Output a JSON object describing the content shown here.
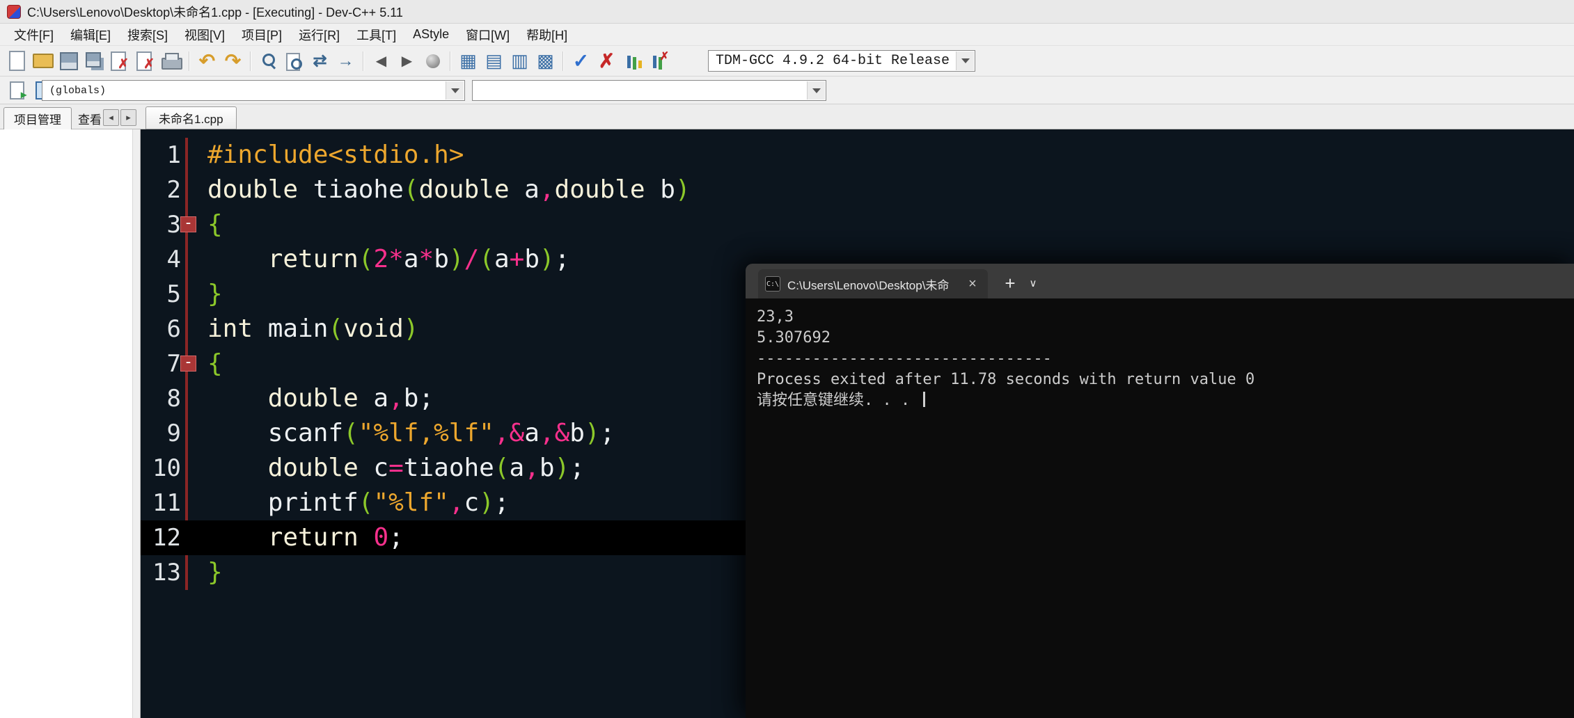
{
  "window": {
    "title": "C:\\Users\\Lenovo\\Desktop\\未命名1.cpp - [Executing] - Dev-C++ 5.11"
  },
  "menu": {
    "items": [
      "文件[F]",
      "编辑[E]",
      "搜索[S]",
      "视图[V]",
      "项目[P]",
      "运行[R]",
      "工具[T]",
      "AStyle",
      "窗口[W]",
      "帮助[H]"
    ]
  },
  "toolbar": {
    "compiler": "TDM-GCC 4.9.2 64-bit Release",
    "groups": [
      [
        "new-file",
        "open",
        "save",
        "save-all",
        "close",
        "close-all",
        "print"
      ],
      [
        "undo",
        "redo"
      ],
      [
        "find",
        "find-in-files",
        "replace",
        "goto-line"
      ],
      [
        "back",
        "forward",
        "run-to-cursor"
      ],
      [
        "compile",
        "run",
        "compile-run",
        "rebuild-all"
      ],
      [
        "syntax-check",
        "abort",
        "profile",
        "profile-delete"
      ]
    ]
  },
  "toolbar2": {
    "buttons": [
      "insert",
      "class-browser"
    ],
    "globals": "(globals)",
    "members": ""
  },
  "panel": {
    "project_label": "项目管理",
    "view_label": "查看"
  },
  "editor_tab": {
    "label": "未命名1.cpp"
  },
  "editor": {
    "lines": [
      {
        "num": 1,
        "tokens": [
          [
            "pre",
            "#include<stdio.h>"
          ]
        ]
      },
      {
        "num": 2,
        "tokens": [
          [
            "kw",
            "double"
          ],
          [
            "pl",
            " tiaohe"
          ],
          [
            "br",
            "("
          ],
          [
            "kw",
            "double"
          ],
          [
            "pl",
            " a"
          ],
          [
            "op",
            ","
          ],
          [
            "kw",
            "double"
          ],
          [
            "pl",
            " b"
          ],
          [
            "br",
            ")"
          ]
        ]
      },
      {
        "num": 3,
        "fold": true,
        "tokens": [
          [
            "br",
            "{"
          ]
        ]
      },
      {
        "num": 4,
        "tokens": [
          [
            "pl",
            "    "
          ],
          [
            "kw",
            "return"
          ],
          [
            "br",
            "("
          ],
          [
            "num",
            "2"
          ],
          [
            "op",
            "*"
          ],
          [
            "pl",
            "a"
          ],
          [
            "op",
            "*"
          ],
          [
            "pl",
            "b"
          ],
          [
            "br",
            ")"
          ],
          [
            "op",
            "/"
          ],
          [
            "br",
            "("
          ],
          [
            "pl",
            "a"
          ],
          [
            "op",
            "+"
          ],
          [
            "pl",
            "b"
          ],
          [
            "br",
            ")"
          ],
          [
            "pl",
            ";"
          ]
        ]
      },
      {
        "num": 5,
        "tokens": [
          [
            "br",
            "}"
          ]
        ]
      },
      {
        "num": 6,
        "tokens": [
          [
            "kw",
            "int"
          ],
          [
            "pl",
            " main"
          ],
          [
            "br",
            "("
          ],
          [
            "kw",
            "void"
          ],
          [
            "br",
            ")"
          ]
        ]
      },
      {
        "num": 7,
        "fold": true,
        "tokens": [
          [
            "br",
            "{"
          ]
        ]
      },
      {
        "num": 8,
        "tokens": [
          [
            "pl",
            "    "
          ],
          [
            "kw",
            "double"
          ],
          [
            "pl",
            " a"
          ],
          [
            "op",
            ","
          ],
          [
            "pl",
            "b;"
          ]
        ]
      },
      {
        "num": 9,
        "tokens": [
          [
            "pl",
            "    scanf"
          ],
          [
            "br",
            "("
          ],
          [
            "str",
            "\"%lf,%lf\""
          ],
          [
            "op",
            ","
          ],
          [
            "op",
            "&"
          ],
          [
            "pl",
            "a"
          ],
          [
            "op",
            ","
          ],
          [
            "op",
            "&"
          ],
          [
            "pl",
            "b"
          ],
          [
            "br",
            ")"
          ],
          [
            "pl",
            ";"
          ]
        ]
      },
      {
        "num": 10,
        "tokens": [
          [
            "pl",
            "    "
          ],
          [
            "kw",
            "double"
          ],
          [
            "pl",
            " c"
          ],
          [
            "op",
            "="
          ],
          [
            "pl",
            "tiaohe"
          ],
          [
            "br",
            "("
          ],
          [
            "pl",
            "a"
          ],
          [
            "op",
            ","
          ],
          [
            "pl",
            "b"
          ],
          [
            "br",
            ")"
          ],
          [
            "pl",
            ";"
          ]
        ]
      },
      {
        "num": 11,
        "tokens": [
          [
            "pl",
            "    printf"
          ],
          [
            "br",
            "("
          ],
          [
            "str",
            "\"%lf\""
          ],
          [
            "op",
            ","
          ],
          [
            "pl",
            "c"
          ],
          [
            "br",
            ")"
          ],
          [
            "pl",
            ";"
          ]
        ]
      },
      {
        "num": 12,
        "highlight": true,
        "tokens": [
          [
            "pl",
            "    "
          ],
          [
            "kw",
            "return"
          ],
          [
            "pl",
            " "
          ],
          [
            "num",
            "0"
          ],
          [
            "pl",
            ";"
          ]
        ]
      },
      {
        "num": 13,
        "tokens": [
          [
            "br",
            "}"
          ]
        ]
      }
    ]
  },
  "terminal": {
    "tab_title": "C:\\Users\\Lenovo\\Desktop\\未命",
    "lines": [
      "23,3",
      "5.307692",
      "--------------------------------",
      "Process exited after 11.78 seconds with return value 0",
      "请按任意键继续. . . "
    ]
  },
  "colors": {
    "chrome_bg": "#f0f0f0",
    "editor_bg": "#0c151e",
    "highlight_line_bg": "#000000",
    "keyword": "#f6f1da",
    "plain_text": "#edf0f2",
    "bracket": "#8cc82a",
    "operator_number": "#f7308c",
    "string_preprocessor": "#eda72e",
    "gutter_text": "#dfe3e6",
    "fold_marker": "#a93636",
    "terminal_bg": "#0c0c0c",
    "terminal_fg": "#cccccc",
    "terminal_tabbar_bg": "#3b3b3b"
  }
}
